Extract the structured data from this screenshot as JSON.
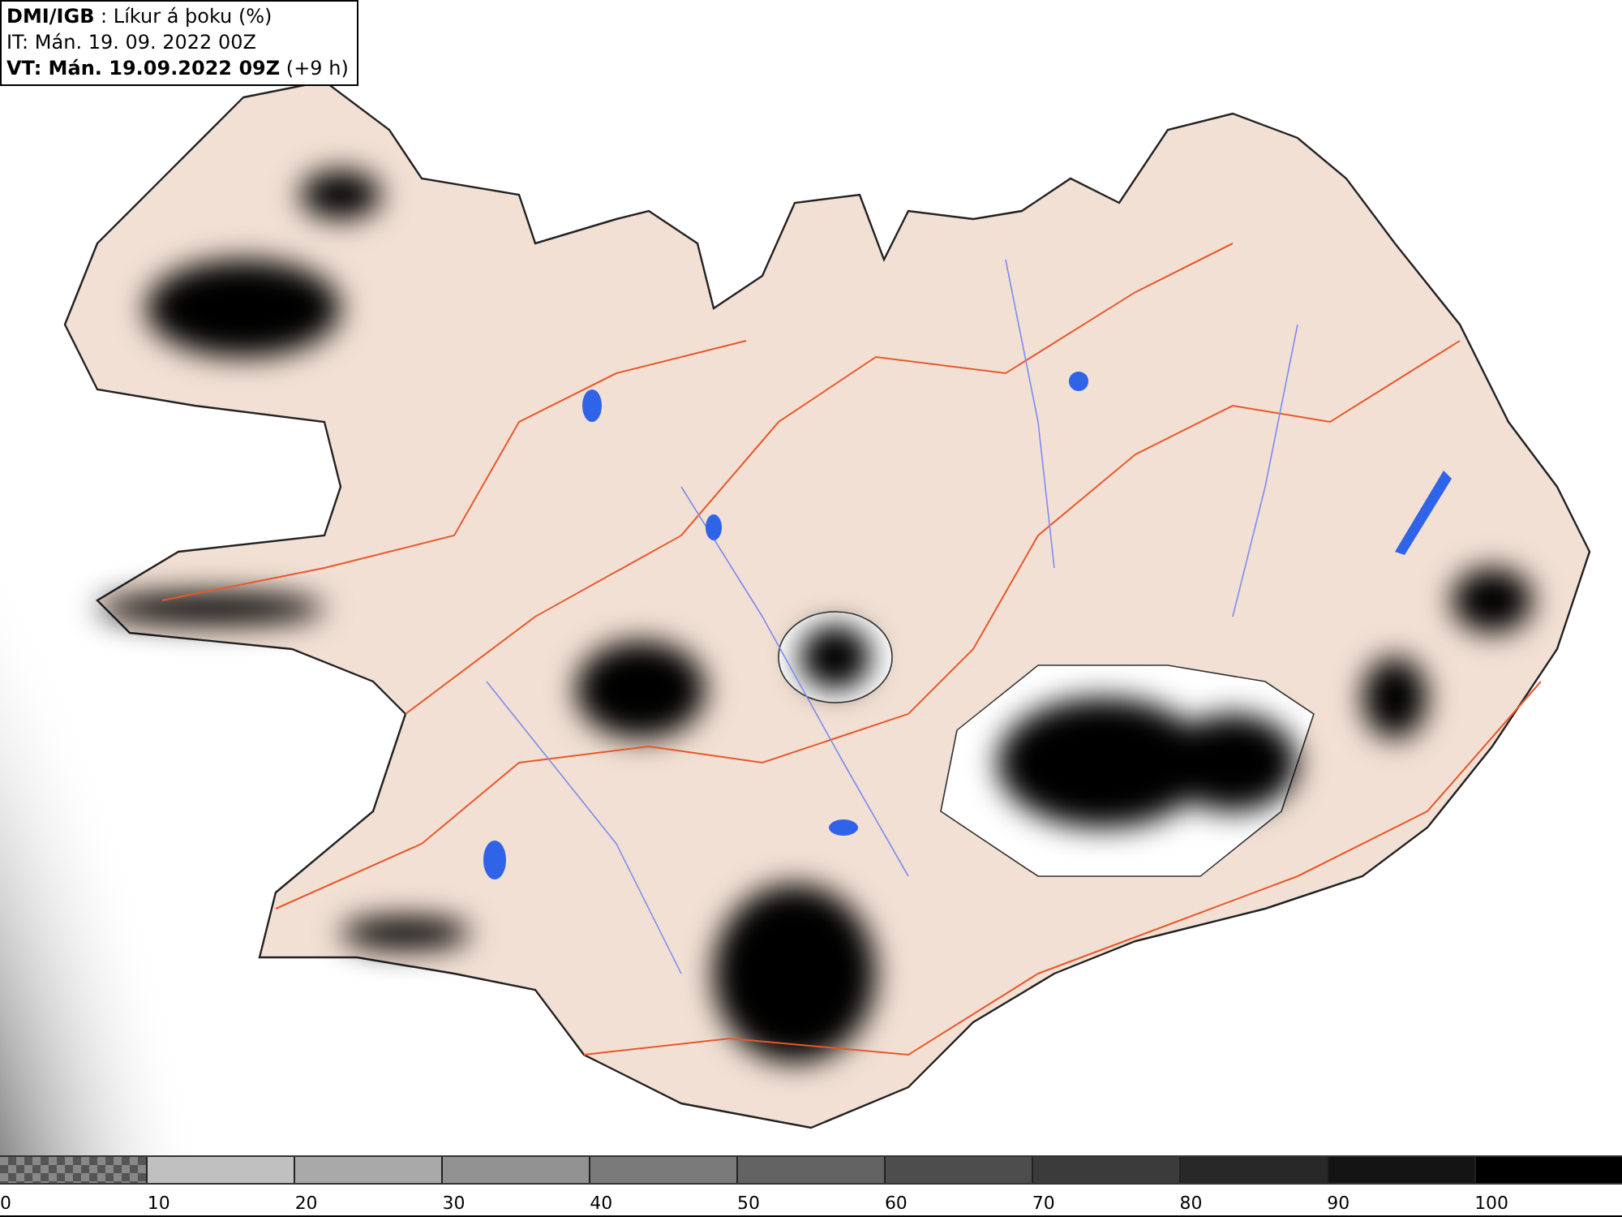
{
  "header": {
    "title": "**DMI/IGB** : Líkur á þoku (%)",
    "init_time": "IT: Mán. 19. 09. 2022 00Z",
    "valid_time": "**VT: Mán. 19.09.2022 09Z** (+9 h)"
  },
  "legend": [
    {
      "label": "0",
      "kind": "checker"
    },
    {
      "label": "10",
      "kind": "solid",
      "color": "#c0c0c0"
    },
    {
      "label": "20",
      "kind": "solid",
      "color": "#a9a9a9"
    },
    {
      "label": "30",
      "kind": "solid",
      "color": "#929292"
    },
    {
      "label": "40",
      "kind": "solid",
      "color": "#7a7a7a"
    },
    {
      "label": "50",
      "kind": "solid",
      "color": "#636363"
    },
    {
      "label": "60",
      "kind": "solid",
      "color": "#4d4d4d"
    },
    {
      "label": "70",
      "kind": "solid",
      "color": "#3b3b3b"
    },
    {
      "label": "80",
      "kind": "solid",
      "color": "#282828"
    },
    {
      "label": "90",
      "kind": "solid",
      "color": "#141414"
    },
    {
      "label": "100",
      "kind": "solid",
      "color": "#000000"
    }
  ]
}
